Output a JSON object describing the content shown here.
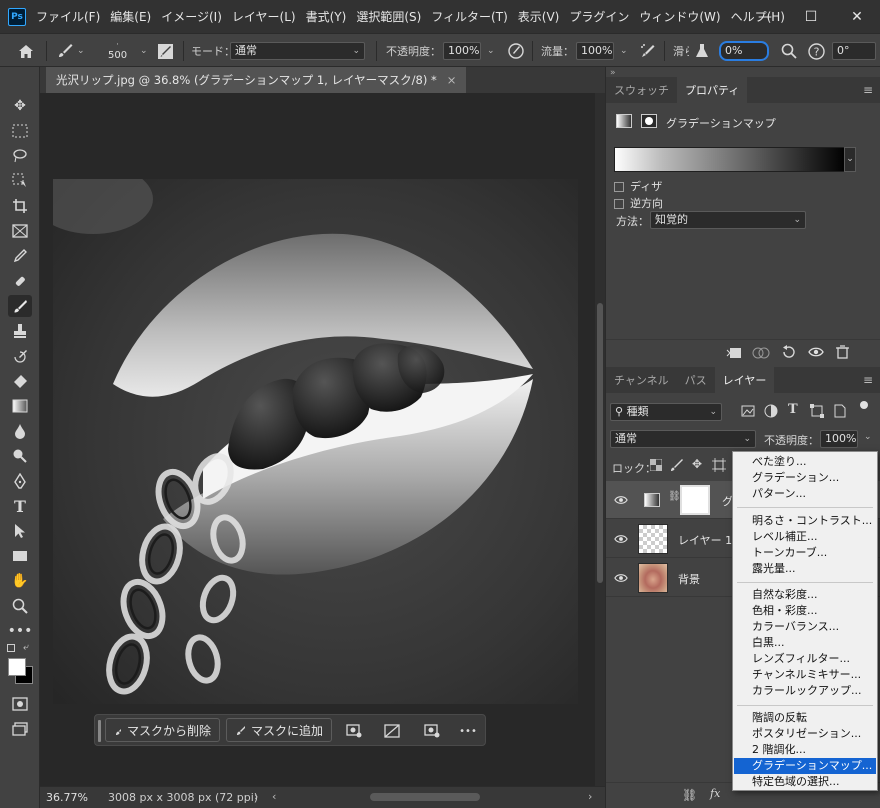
{
  "app": {
    "logo": "Ps",
    "menu": [
      "ファイル(F)",
      "編集(E)",
      "イメージ(I)",
      "レイヤー(L)",
      "書式(Y)",
      "選択範囲(S)",
      "フィルター(T)",
      "表示(V)",
      "プラグイン",
      "ウィンドウ(W)",
      "ヘルプ(H)"
    ],
    "window_controls": [
      "—",
      "☐",
      "✕"
    ]
  },
  "options": {
    "brush_size": "500",
    "mode_label": "モード：",
    "mode_value": "通常",
    "opacity_label": "不透明度：",
    "opacity_value": "100%",
    "flow_label": "流量：",
    "flow_value": "100%",
    "smoothing_label": "滑らかさ：",
    "smoothing_value": "0%",
    "angle_value": "0°"
  },
  "document": {
    "tab_title": "光沢リップ.jpg @ 36.8% (グラデーションマップ 1, レイヤーマスク/8) *",
    "close": "×",
    "zoom": "36.77%",
    "dimensions": "3008 px x 3008 px (72 ppi)",
    "status_chevron": "›",
    "scroll_left": "‹",
    "scroll_right": "›"
  },
  "taskbar": {
    "subtract_label": "マスクから削除",
    "add_label": "マスクに追加",
    "more": "•••"
  },
  "properties": {
    "tabs": [
      "スウォッチ",
      "プロパティ"
    ],
    "heading": "グラデーションマップ",
    "dither_label": "ディザ",
    "reverse_label": "逆方向",
    "method_label": "方法：",
    "method_value": "知覚的"
  },
  "layers_panel": {
    "tabs": [
      "チャンネル",
      "パス",
      "レイヤー"
    ],
    "filter_value": "種類",
    "blend_value": "通常",
    "opacity_label": "不透明度：",
    "opacity_value": "100%",
    "lock_label": "ロック：",
    "layers": [
      {
        "name": "グ"
      },
      {
        "name": "レイヤー 1"
      },
      {
        "name": "背景"
      }
    ],
    "footer_fx": "fx"
  },
  "adjustment_menu": {
    "groups": [
      [
        "べた塗り...",
        "グラデーション...",
        "パターン..."
      ],
      [
        "明るさ・コントラスト...",
        "レベル補正...",
        "トーンカーブ...",
        "露光量..."
      ],
      [
        "自然な彩度...",
        "色相・彩度...",
        "カラーバランス...",
        "白黒...",
        "レンズフィルター...",
        "チャンネルミキサー...",
        "カラールックアップ..."
      ],
      [
        "階調の反転",
        "ポスタリゼーション...",
        "2 階調化...",
        "グラデーションマップ...",
        "特定色域の選択..."
      ]
    ],
    "highlighted": "グラデーションマップ..."
  },
  "colors": {
    "accent": "#1464d2",
    "focus_ring": "#2a7de1",
    "panel_bg": "#424242",
    "menu_bg": "#f0f0f0"
  },
  "icons": [
    "home-icon",
    "brush-icon",
    "search-icon",
    "help-icon",
    "eye-icon",
    "trash-icon",
    "link-icon",
    "lock-icon",
    "hand-icon",
    "zoom-icon"
  ]
}
